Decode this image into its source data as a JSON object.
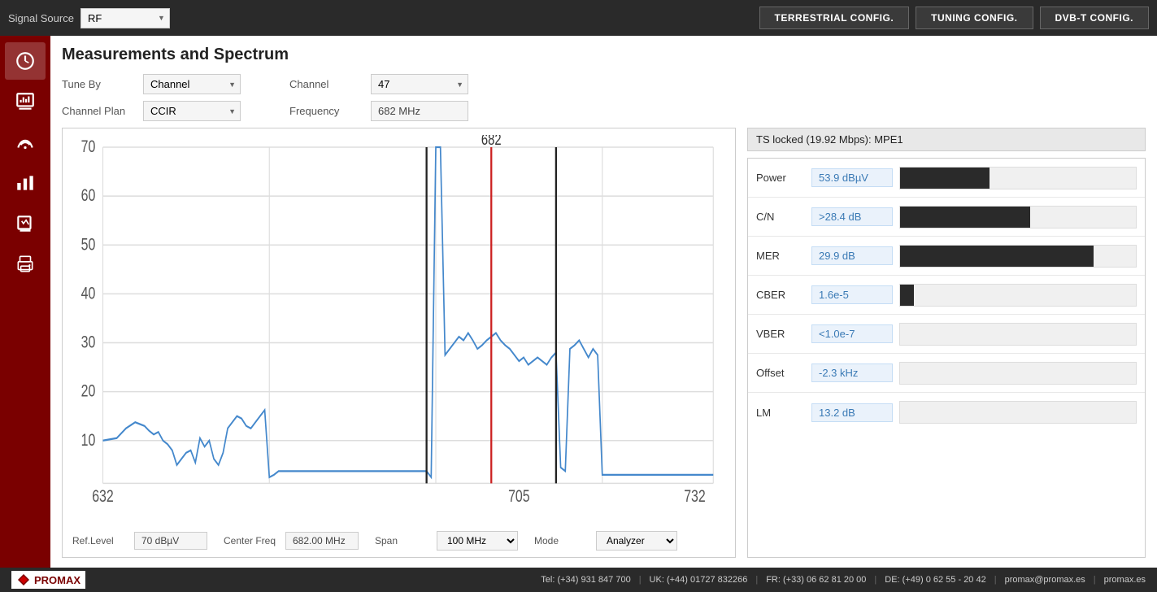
{
  "topbar": {
    "signal_source_label": "Signal Source",
    "signal_source_value": "RF",
    "btn_terrestrial": "TERRESTRIAL CONFIG.",
    "btn_tuning": "TUNING CONFIG.",
    "btn_dvbt": "DVB-T CONFIG."
  },
  "page": {
    "title": "Measurements and Spectrum"
  },
  "controls": {
    "tune_by_label": "Tune By",
    "tune_by_value": "Channel",
    "channel_plan_label": "Channel Plan",
    "channel_plan_value": "CCIR",
    "channel_label": "Channel",
    "channel_value": "47",
    "frequency_label": "Frequency",
    "frequency_value": "682 MHz"
  },
  "chart": {
    "ref_level_label": "Ref.Level",
    "ref_level_value": "70 dBµV",
    "center_freq_label": "Center Freq",
    "center_freq_value": "682.00 MHz",
    "span_label": "Span",
    "span_value": "100 MHz",
    "mode_label": "Mode",
    "mode_value": "Analyzer",
    "x_labels": [
      "632",
      "705",
      "732"
    ],
    "y_labels": [
      "70",
      "60",
      "50",
      "40",
      "30",
      "20",
      "10"
    ],
    "center_marker": "682"
  },
  "ts_status": {
    "text": "TS locked (19.92 Mbps): MPE1"
  },
  "measurements": [
    {
      "name": "Power",
      "value": "53.9 dBµV",
      "bar_pct": 38
    },
    {
      "name": "C/N",
      "value": ">28.4 dB",
      "bar_pct": 55
    },
    {
      "name": "MER",
      "value": "29.9 dB",
      "bar_pct": 82
    },
    {
      "name": "CBER",
      "value": "1.6e-5",
      "bar_pct": 6
    },
    {
      "name": "VBER",
      "value": "<1.0e-7",
      "bar_pct": 0
    },
    {
      "name": "Offset",
      "value": "-2.3 kHz",
      "bar_pct": 0
    },
    {
      "name": "LM",
      "value": "13.2 dB",
      "bar_pct": 0
    }
  ],
  "footer": {
    "logo_text": "PROMAX",
    "tel_es": "Tel: (+34) 931 847 700",
    "tel_uk": "UK: (+44) 01727 832266",
    "tel_fr": "FR: (+33) 06 62 81 20 00",
    "tel_de": "DE: (+49) 0 62 55 - 20 42",
    "email": "promax@promax.es",
    "website": "promax.es"
  },
  "sidebar": {
    "items": [
      {
        "name": "dashboard-icon",
        "label": "Dashboard"
      },
      {
        "name": "measurements-icon",
        "label": "Measurements"
      },
      {
        "name": "signal-icon",
        "label": "Signal"
      },
      {
        "name": "bar-chart-icon",
        "label": "Bar Chart"
      },
      {
        "name": "datalogger-icon",
        "label": "Datalogger"
      },
      {
        "name": "print-icon",
        "label": "Print"
      }
    ]
  }
}
